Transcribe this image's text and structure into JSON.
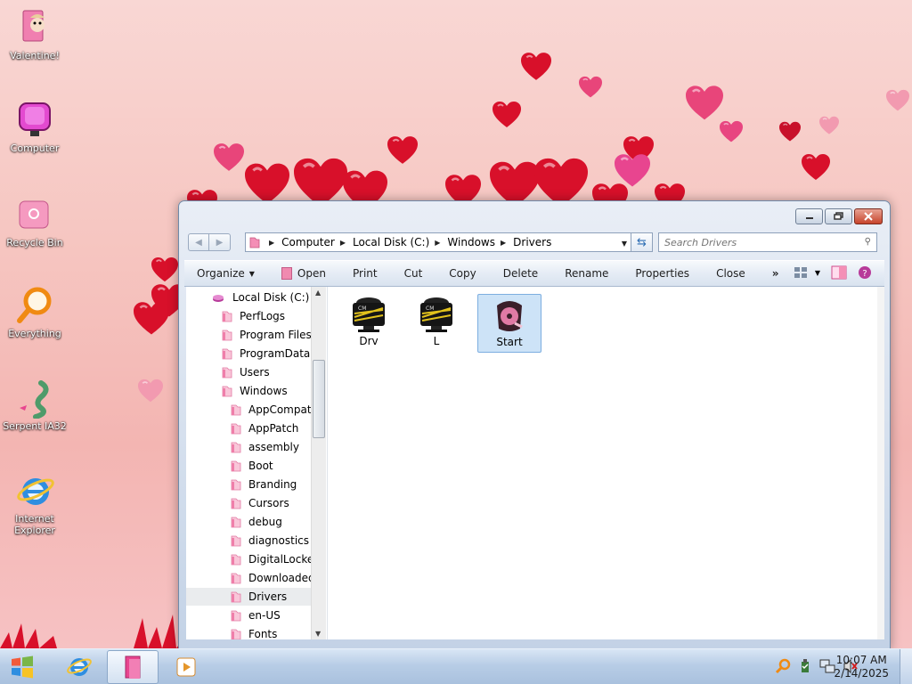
{
  "desktop": {
    "icons": [
      {
        "label": "Valentine!",
        "icon": "pink-folder-character-icon"
      },
      {
        "label": "Computer",
        "icon": "pink-monitor-icon"
      },
      {
        "label": "Recycle Bin",
        "icon": "pink-recycle-bin-icon"
      },
      {
        "label": "Everything",
        "icon": "orange-magnifier-icon"
      },
      {
        "label": "Serpent IA32",
        "icon": "green-serpent-icon"
      },
      {
        "label": "Internet Explorer",
        "icon": "internet-explorer-icon"
      }
    ]
  },
  "window": {
    "caption": {
      "minimize": "minimize",
      "maximize": "maximize",
      "close": "close"
    },
    "address": {
      "crumbs": [
        "Computer",
        "Local Disk (C:)",
        "Windows",
        "Drivers"
      ]
    },
    "search": {
      "placeholder": "Search Drivers"
    },
    "toolbar": {
      "organize": "Organize",
      "open": "Open",
      "print": "Print",
      "cut": "Cut",
      "copy": "Copy",
      "delete": "Delete",
      "rename": "Rename",
      "properties": "Properties",
      "close": "Close",
      "more": "»"
    },
    "nav_tree": [
      {
        "label": "Local Disk (C:)",
        "level": 0
      },
      {
        "label": "PerfLogs",
        "level": 1
      },
      {
        "label": "Program Files",
        "level": 1
      },
      {
        "label": "ProgramData",
        "level": 1
      },
      {
        "label": "Users",
        "level": 1
      },
      {
        "label": "Windows",
        "level": 1
      },
      {
        "label": "AppCompat",
        "level": 2
      },
      {
        "label": "AppPatch",
        "level": 2
      },
      {
        "label": "assembly",
        "level": 2
      },
      {
        "label": "Boot",
        "level": 2
      },
      {
        "label": "Branding",
        "level": 2
      },
      {
        "label": "Cursors",
        "level": 2
      },
      {
        "label": "debug",
        "level": 2
      },
      {
        "label": "diagnostics",
        "level": 2
      },
      {
        "label": "DigitalLocker",
        "level": 2
      },
      {
        "label": "Downloaded",
        "level": 2
      },
      {
        "label": "Drivers",
        "level": 2,
        "selected": true
      },
      {
        "label": "en-US",
        "level": 2
      },
      {
        "label": "Fonts",
        "level": 2
      }
    ],
    "files": [
      {
        "label": "Drv",
        "icon": "cmd-monitor-icon"
      },
      {
        "label": "L",
        "icon": "cmd-monitor-icon"
      },
      {
        "label": "Start",
        "icon": "pink-disc-icon",
        "selected": true
      }
    ]
  },
  "taskbar": {
    "clock_time": "10:07 AM",
    "clock_date": "2/14/2025"
  },
  "colors": {
    "accent_pink": "#e8458f",
    "heart_red": "#d8102a",
    "selection_blue": "#cde3f7"
  }
}
